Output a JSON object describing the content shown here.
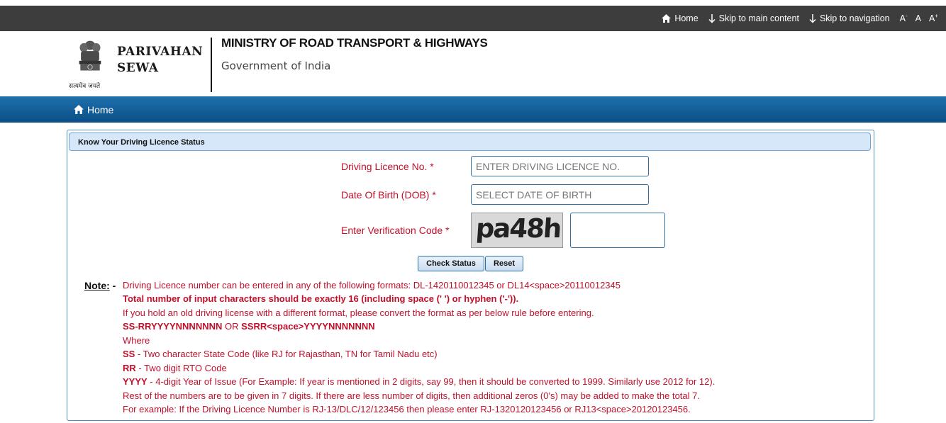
{
  "top_links": {
    "home": "Home",
    "skip_main": "Skip to main content",
    "skip_nav": "Skip to navigation",
    "font_decrease": "A",
    "font_normal": "A",
    "font_increase": "A",
    "minus": "-",
    "plus": "+"
  },
  "header": {
    "emblem_motto": "सत्यमेव जयते",
    "brand_line1": "PARIVAHAN",
    "brand_line2": "SEWA",
    "ministry": "MINISTRY OF ROAD TRANSPORT & HIGHWAYS",
    "government": "Government of India"
  },
  "nav": {
    "home": "Home"
  },
  "panel": {
    "title": "Know Your Driving Licence Status"
  },
  "form": {
    "dl_label": "Driving Licence No.  *",
    "dl_placeholder": "ENTER DRIVING LICENCE NO.",
    "dob_label": "Date Of Birth (DOB)  *",
    "dob_placeholder": "SELECT DATE OF BIRTH",
    "captcha_label": "Enter Verification Code  *",
    "captcha_text": "pa48h",
    "check_button": "Check Status",
    "reset_button": "Reset"
  },
  "note": {
    "label": "Note:",
    "dash": " -",
    "line1": "Driving Licence number can be entered in any of the following formats: DL-1420110012345 or DL14<space>20110012345",
    "line2": "Total number of input characters should be exactly 16 (including space (' ') or hyphen ('-')).",
    "line3": "If you hold an old driving license with a different format, please convert the format as per below rule before entering.",
    "line4a": "SS-RRYYYYNNNNNNN",
    "line4b": " OR ",
    "line4c": "SSRR<space>YYYYNNNNNNN",
    "line5": "Where",
    "line6a": "SS",
    "line6b": " - Two character State Code (like RJ for Rajasthan, TN for Tamil Nadu etc)",
    "line7a": "RR",
    "line7b": " - Two digit RTO Code",
    "line8a": "YYYY",
    "line8b": " - 4-digit Year of Issue (For Example: If year is mentioned in 2 digits, say 99, then it should be converted to 1999. Similarly use 2012 for 12).",
    "line9": "Rest of the numbers are to be given in 7 digits. If there are less number of digits, then additional zeros (0's) may be added to make the total 7.",
    "line10": "For example: If the Driving Licence Number is RJ-13/DLC/12/123456 then please enter RJ-1320120123456 or RJ13<space>20120123456."
  },
  "colors": {
    "accent_red": "#c0102a",
    "nav_blue": "#0a4e86",
    "topbar": "#3d3d3d"
  }
}
